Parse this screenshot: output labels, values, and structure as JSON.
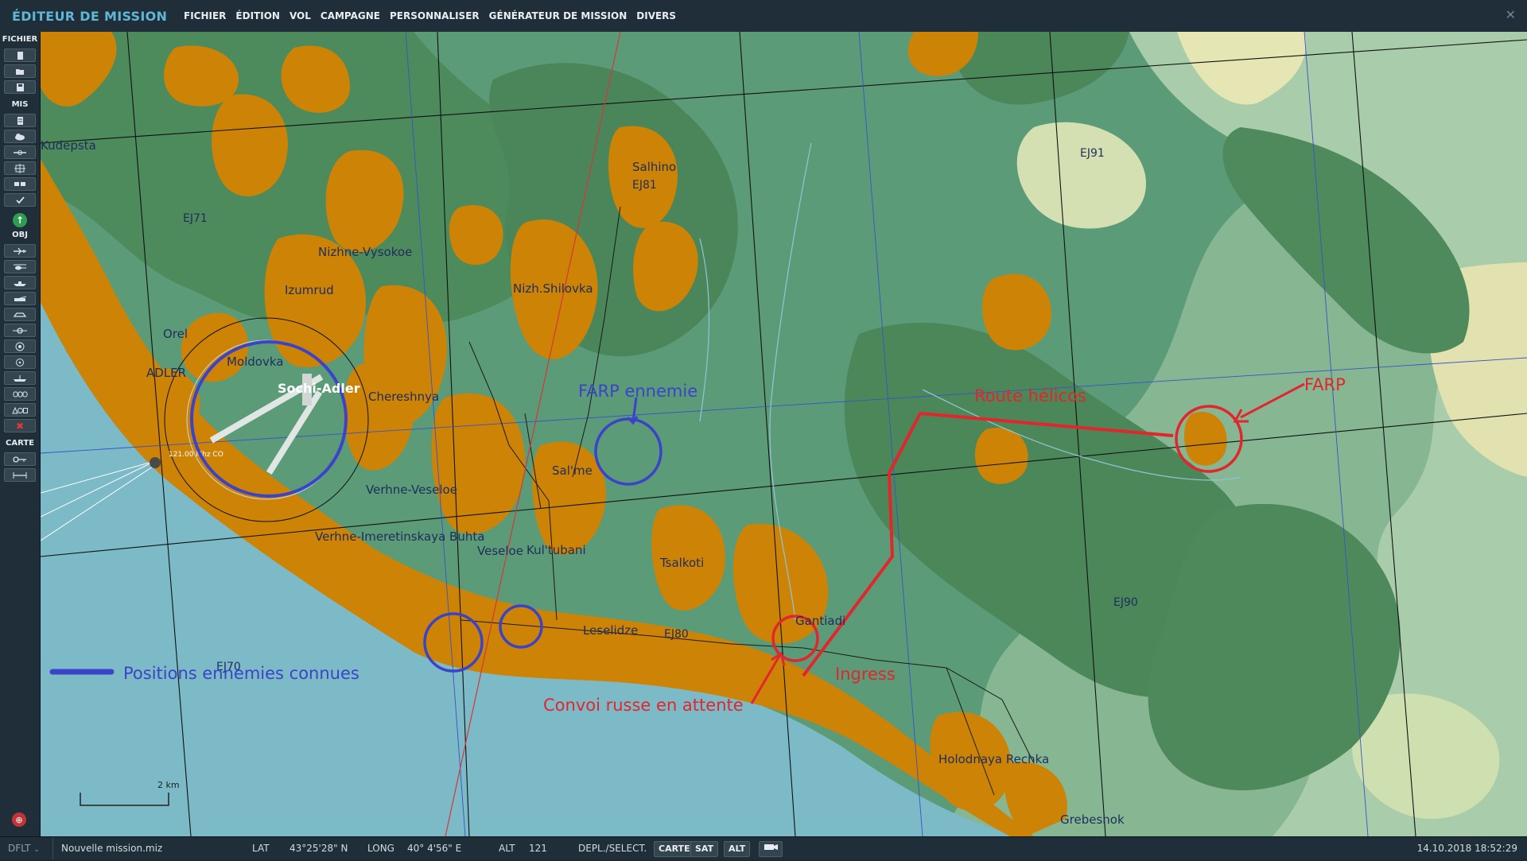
{
  "app": {
    "title": "ÉDITEUR DE MISSION",
    "close_glyph": "✕"
  },
  "menu": [
    {
      "label": "FICHIER"
    },
    {
      "label": "ÉDITION"
    },
    {
      "label": "VOL"
    },
    {
      "label": "CAMPAGNE"
    },
    {
      "label": "PERSONNALISER"
    },
    {
      "label": "GÉNÉRATEUR DE MISSION"
    },
    {
      "label": "DIVERS"
    }
  ],
  "sidebar": {
    "sections": {
      "fichier": "FICHIER",
      "mis": "MIS",
      "obj": "OBJ",
      "carte": "CARTE"
    },
    "icons": {
      "fichier": [
        "new-file-icon",
        "open-folder-icon",
        "save-icon"
      ],
      "mis": [
        "briefing-icon",
        "weather-icon",
        "aircraft-group-icon",
        "static-object-icon",
        "trigger-zone-icon",
        "check-icon"
      ],
      "obj": [
        "plane-icon",
        "helicopter-icon",
        "ship-icon",
        "ground-unit-icon",
        "armor-icon",
        "waypoint-icon",
        "target-icon",
        "zone-icon",
        "carrier-icon",
        "formation-icon",
        "shapes-icon",
        "delete-icon"
      ],
      "carte": [
        "map-key-icon",
        "ruler-icon"
      ]
    }
  },
  "map": {
    "places": {
      "kudepsta": "Kudepsta",
      "orel": "Orel",
      "adler": "ADLER",
      "moldovka": "Moldovka",
      "sochi_adler": "Sochi-Adler",
      "izumrud": "Izumrud",
      "nizhne_vysokoe": "Nizhne-Vysokoe",
      "chereshnya": "Chereshnya",
      "nizh_shilovka": "Nizh.Shilovka",
      "salhino": "Salhino",
      "salme": "Sal'me",
      "verhne_veseloe": "Verhne-Veseloe",
      "verhne_imeretinskaya": "Verhne-Imeretinskaya Buhta",
      "veseloe": "Veseloe",
      "kultubani": "Kul'tubani",
      "tsalkoti": "Tsalkoti",
      "leselidze": "Leselidze",
      "gantiadi": "Gantiadi",
      "holodnaya": "Holodnaya Rechka",
      "grebeshok": "Grebeshok"
    },
    "grid": {
      "ej71": "EJ71",
      "ej81": "EJ81",
      "ej91": "EJ91",
      "ej70": "EJ70",
      "ej80": "EJ80",
      "ej90": "EJ90"
    },
    "airport_freq": "121.00 Mhz CO",
    "annotations": {
      "farp_ennemie": "FARP ennemie",
      "route_helicos": "Route hélicos",
      "farp": "FARP",
      "ingress": "Ingress",
      "convoi": "Convoi russe en attente",
      "legend": "Positions ennemies connues"
    },
    "scale": "2 km",
    "colors": {
      "enemy_blue": "#3b43c9",
      "friendly_red": "#e2262d",
      "urban": "#cc8306",
      "forest": "#4f8a5e",
      "sea": "#7bbac6"
    }
  },
  "status": {
    "profile": "DFLT",
    "filename": "Nouvelle mission.miz",
    "lat_label": "LAT",
    "lat_value": "43°25'28\" N",
    "long_label": "LONG",
    "long_value": "40° 4'56\" E",
    "alt_label": "ALT",
    "alt_value": "121",
    "mode_label": "DEPL./SELECT.",
    "btn_carte": "CARTE",
    "btn_sat": "SAT",
    "btn_alt": "ALT",
    "datetime": "14.10.2018 18:52:29"
  }
}
